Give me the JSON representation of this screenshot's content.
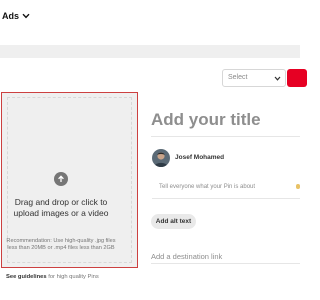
{
  "header": {
    "ads_menu": {
      "label": "Ads",
      "icon": "chevron-down-icon"
    }
  },
  "toolbar": {
    "board_select": {
      "value": "Select",
      "icon": "chevron-down-icon"
    },
    "publish_color": "#e60023"
  },
  "upload": {
    "title": "Drag and drop or click to upload images or a video",
    "recommendation": "Recommendation: Use high-quality .jpg files less than 20MB or .mp4 files less than 2GB",
    "guidelines_prefix": "See guidelines",
    "guidelines_suffix": " for high quality Pins",
    "icon": "arrow-up-icon",
    "border_color": "#cc4040"
  },
  "form": {
    "title_placeholder": "Add your title",
    "user_name": "Josef Mohamed",
    "description_placeholder": "Tell everyone what your Pin is about",
    "alt_text_label": "Add alt text",
    "destination_placeholder": "Add a destination link"
  }
}
